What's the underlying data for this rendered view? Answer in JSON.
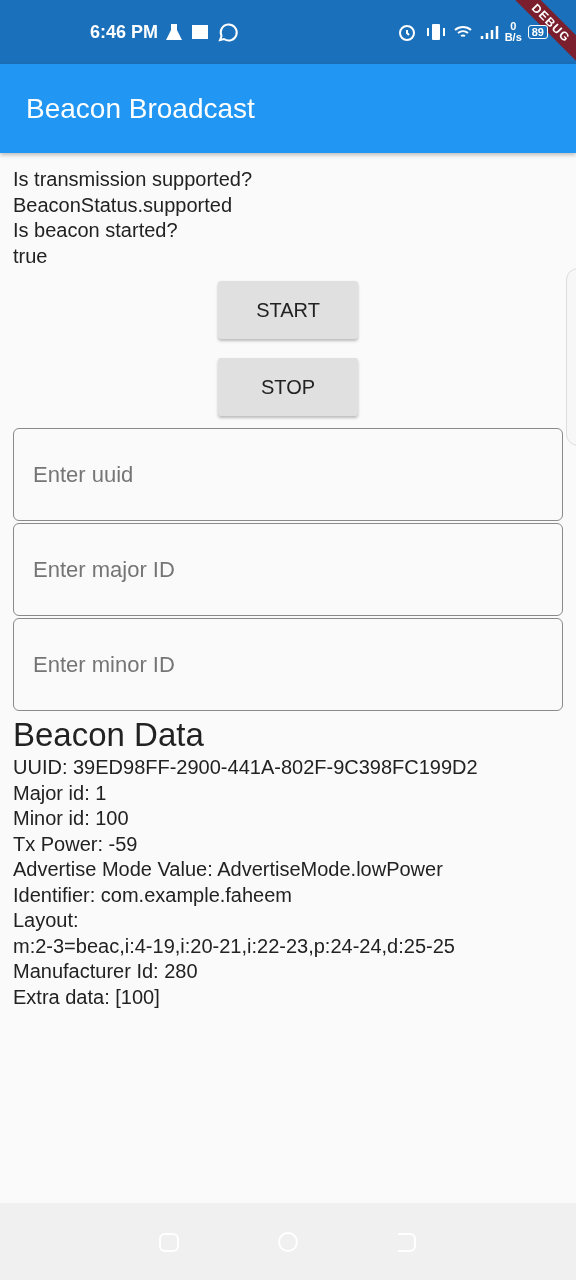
{
  "status_bar": {
    "time": "6:46 PM",
    "net_speed_value": "0",
    "net_speed_unit": "B/s",
    "battery": "89"
  },
  "debug_banner": "DEBUG",
  "app_bar": {
    "title": "Beacon Broadcast"
  },
  "status_lines": [
    "Is transmission supported?",
    "BeaconStatus.supported",
    "Is beacon started?",
    "true"
  ],
  "buttons": [
    "START",
    "STOP"
  ],
  "fields": [
    {
      "placeholder": "Enter uuid"
    },
    {
      "placeholder": "Enter major ID"
    },
    {
      "placeholder": "Enter minor ID"
    }
  ],
  "beacon_data": {
    "heading": "Beacon Data",
    "lines": [
      "UUID: 39ED98FF-2900-441A-802F-9C398FC199D2",
      "Major id: 1",
      "Minor id: 100",
      "Tx Power: -59",
      "Advertise Mode Value: AdvertiseMode.lowPower",
      "Identifier: com.example.faheem",
      "Layout:",
      "m:2-3=beac,i:4-19,i:20-21,i:22-23,p:24-24,d:25-25",
      "Manufacturer Id: 280",
      "Extra data: [100]"
    ]
  }
}
